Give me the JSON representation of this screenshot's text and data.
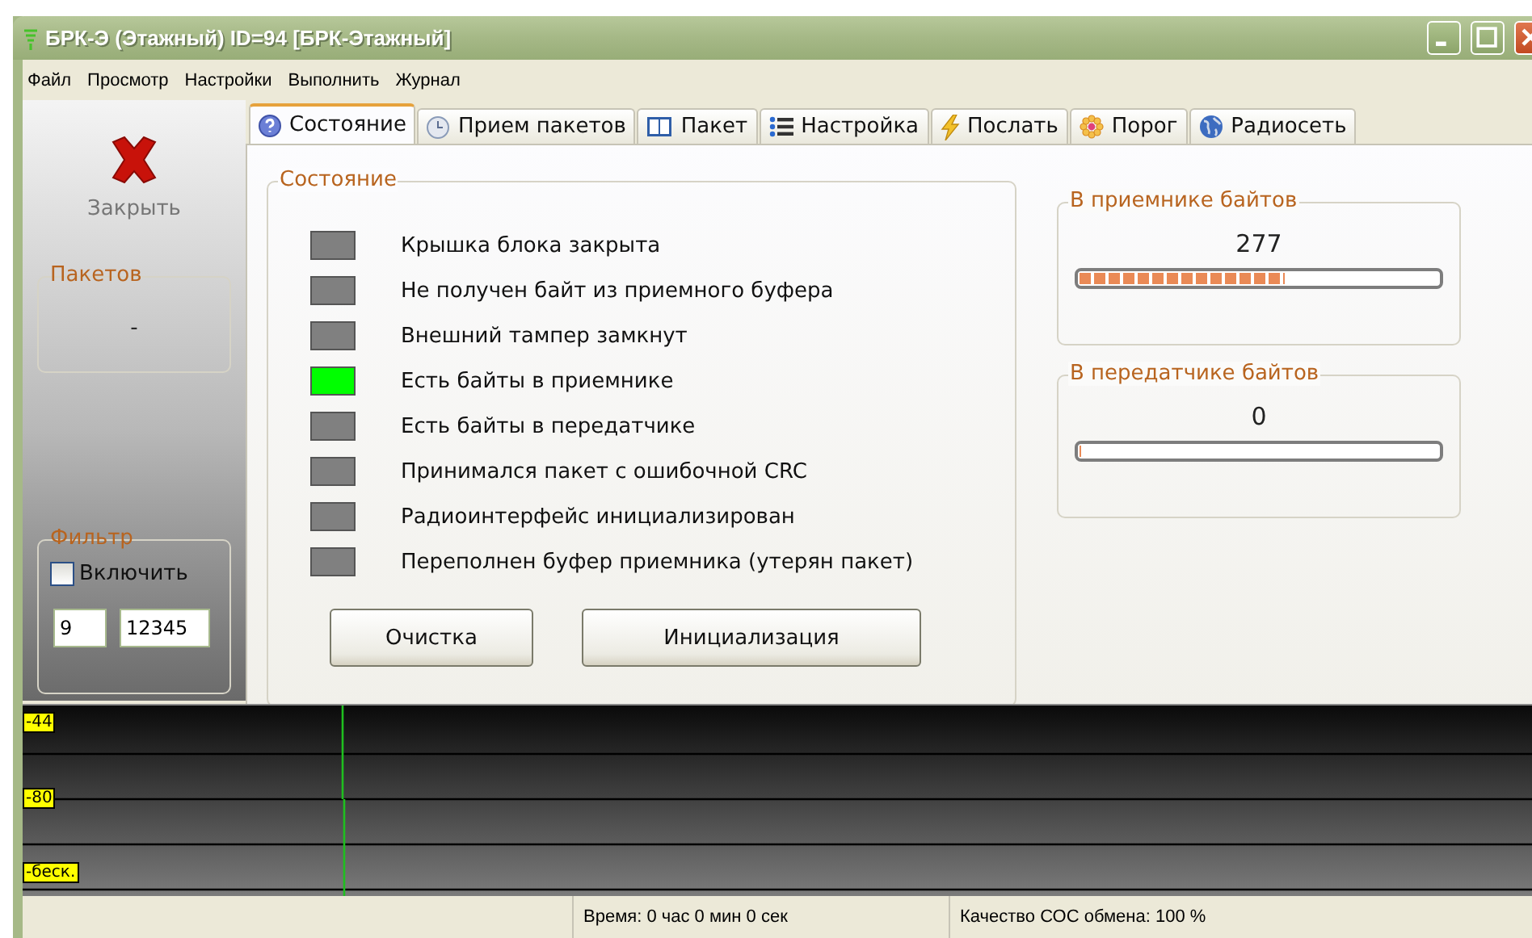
{
  "window": {
    "title": "БРК-Э  (Этажный)  ID=94 [БРК-Этажный]"
  },
  "menu": [
    "Файл",
    "Просмотр",
    "Настройки",
    "Выполнить",
    "Журнал"
  ],
  "sidebar": {
    "close_label": "Закрыть",
    "packets": {
      "title": "Пакетов",
      "value": "-"
    },
    "filter": {
      "title": "Фильтр",
      "enable_label": "Включить",
      "checked": false,
      "field_1": "9",
      "field_2": "12345"
    }
  },
  "tabs": [
    {
      "label": "Состояние",
      "selected": true
    },
    {
      "label": "Прием пакетов",
      "selected": false
    },
    {
      "label": "Пакет",
      "selected": false
    },
    {
      "label": "Настройка",
      "selected": false
    },
    {
      "label": "Послать",
      "selected": false
    },
    {
      "label": "Порог",
      "selected": false
    },
    {
      "label": "Радиосеть",
      "selected": false
    }
  ],
  "status_group": {
    "title": "Состояние",
    "items": [
      {
        "label": "Крышка блока закрыта",
        "on": false
      },
      {
        "label": "Не получен байт из приемного буфера",
        "on": false
      },
      {
        "label": "Внешний тампер замкнут",
        "on": false
      },
      {
        "label": "Есть байты в приемнике",
        "on": true
      },
      {
        "label": "Есть байты в передатчике",
        "on": false
      },
      {
        "label": "Принимался пакет с ошибочной CRC",
        "on": false
      },
      {
        "label": "Радиоинтерфейс инициализирован",
        "on": false
      },
      {
        "label": "Переполнен буфер приемника  (утерян пакет)",
        "on": false
      }
    ],
    "buttons": [
      "Очистка",
      "Инициализация"
    ]
  },
  "meters": [
    {
      "title": "В приемнике байтов",
      "reading": "277",
      "level": 0.57
    },
    {
      "title": "В передатчике байтов",
      "reading": "0",
      "level": 0
    }
  ],
  "signal_scale": [
    "-44",
    "-80",
    "-беск."
  ],
  "status_bar": [
    "Время: 0 час 0 мин 0 сек",
    "Качество СОС обмена: 100 %"
  ]
}
